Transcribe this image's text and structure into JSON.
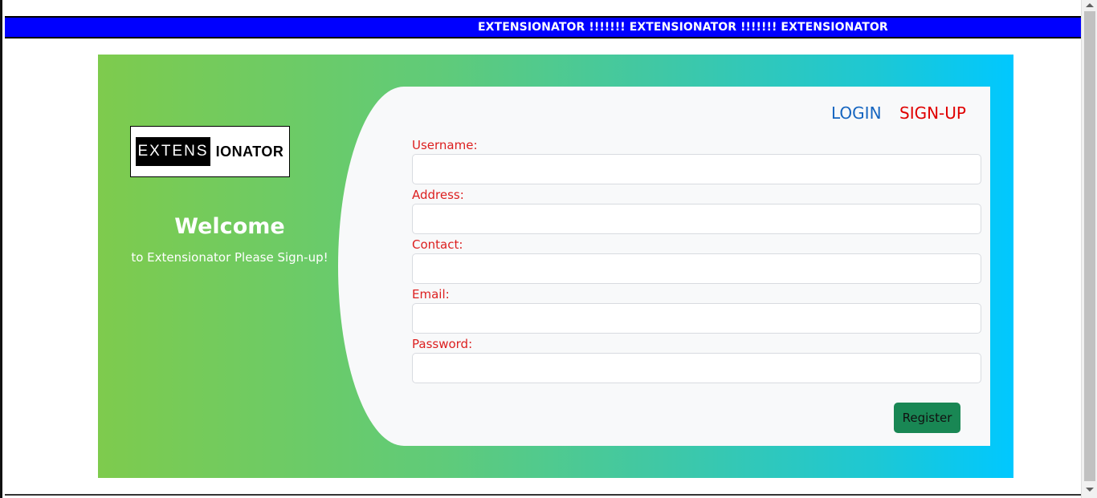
{
  "banner": {
    "text": "EXTENSIONATOR !!!!!!! EXTENSIONATOR !!!!!!! EXTENSIONATOR"
  },
  "brand": {
    "logo_left": "EXTENS",
    "logo_right": "IONATOR",
    "welcome_title": "Welcome",
    "welcome_subtitle": "to Extensionator Please Sign-up!"
  },
  "nav": {
    "login_label": "LOGIN",
    "signup_label": "SIGN-UP"
  },
  "form": {
    "fields": [
      {
        "label": "Username:",
        "value": ""
      },
      {
        "label": "Address:",
        "value": ""
      },
      {
        "label": "Contact:",
        "value": ""
      },
      {
        "label": "Email:",
        "value": ""
      },
      {
        "label": "Password:",
        "value": ""
      }
    ],
    "submit_label": "Register"
  },
  "colors": {
    "banner_bg": "#0000ff",
    "gradient_start": "#7ecb4d",
    "gradient_end": "#00c8ff",
    "label_color": "#dc1f1f",
    "login_color": "#1565c0",
    "signup_color": "#e00000",
    "button_bg": "#198754"
  }
}
